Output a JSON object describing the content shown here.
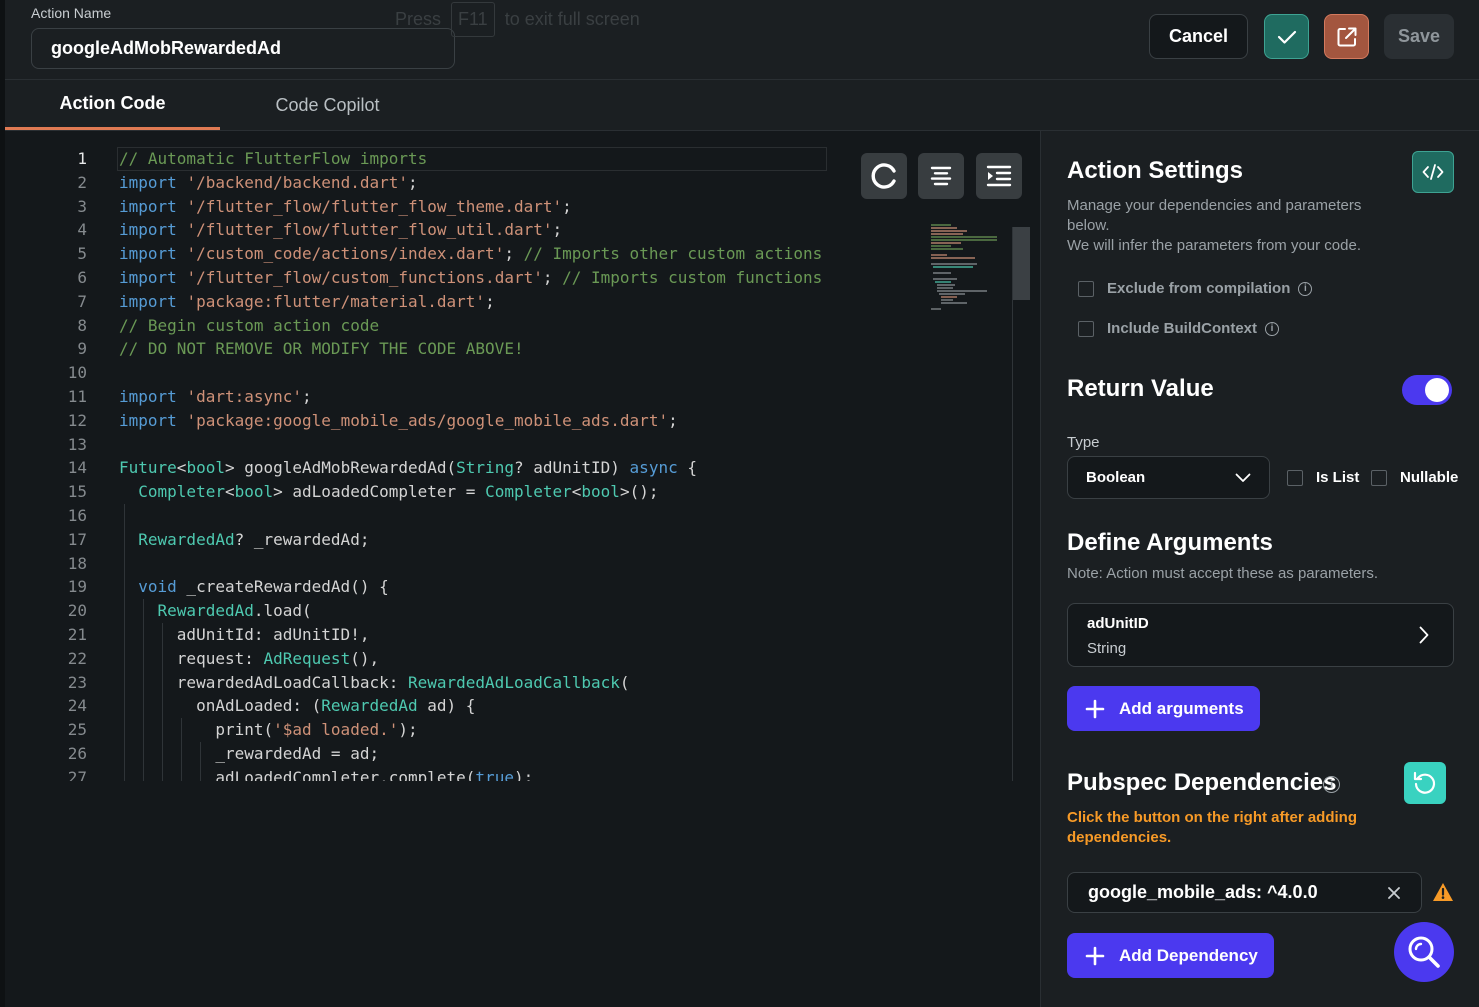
{
  "header": {
    "action_name_label": "Action Name",
    "action_name_value": "googleAdMobRewardedAd",
    "fullscreen_hint": {
      "before": "Press",
      "key": "F11",
      "after": "to exit full screen"
    },
    "cancel_label": "Cancel",
    "save_label": "Save"
  },
  "tabs": [
    {
      "label": "Action Code",
      "active": true
    },
    {
      "label": "Code Copilot",
      "active": false
    }
  ],
  "editor": {
    "active_line": 1,
    "line_numbers": [
      "1",
      "2",
      "3",
      "4",
      "5",
      "6",
      "7",
      "8",
      "9",
      "10",
      "11",
      "12",
      "13",
      "14",
      "15",
      "16",
      "17",
      "18",
      "19",
      "20",
      "21",
      "22",
      "23",
      "24",
      "25",
      "26",
      "27"
    ]
  },
  "settings": {
    "title": "Action Settings",
    "desc_1": "Manage your dependencies and parameters below.",
    "desc_2": "We will infer the parameters from your code.",
    "exclude_label": "Exclude from compilation",
    "exclude_checked": false,
    "buildcontext_label": "Include BuildContext",
    "buildcontext_checked": false,
    "return_title": "Return Value",
    "return_enabled": true,
    "type_label": "Type",
    "type_value": "Boolean",
    "is_list_label": "Is List",
    "is_list_checked": false,
    "nullable_label": "Nullable",
    "nullable_checked": false,
    "args_title": "Define Arguments",
    "args_note": "Note: Action must accept these as parameters.",
    "arguments": [
      {
        "name": "adUnitID",
        "type": "String"
      }
    ],
    "add_arguments_label": "Add arguments",
    "pubspec_title": "Pubspec Dependencies",
    "pubspec_warning": "Click the button on the right after adding dependencies.",
    "dependencies": [
      "google_mobile_ads: ^4.0.0"
    ],
    "add_dependency_label": "Add Dependency"
  },
  "colors": {
    "accent_primary": "#4b39ef",
    "accent_secondary": "#39d2c0",
    "tab_underline": "#e07a53",
    "warning": "#f79a27"
  }
}
